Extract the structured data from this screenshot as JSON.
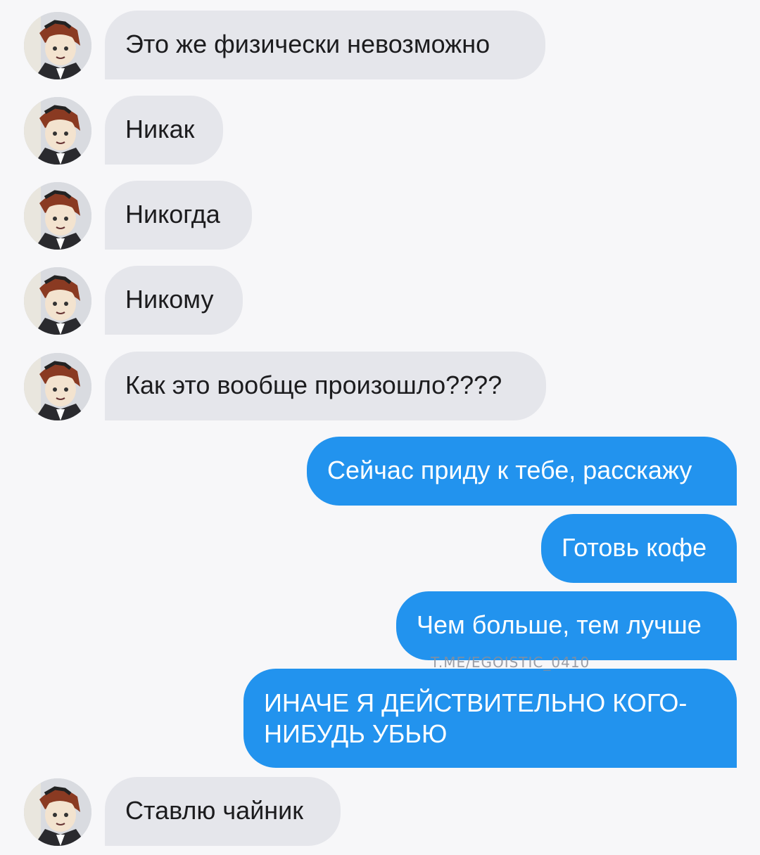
{
  "messages": [
    {
      "side": "in",
      "text": "Это же физически невозможно"
    },
    {
      "side": "in",
      "text": "Никак"
    },
    {
      "side": "in",
      "text": "Никогда"
    },
    {
      "side": "in",
      "text": "Никому"
    },
    {
      "side": "in",
      "text": "Как это вообще произошло????"
    },
    {
      "side": "out",
      "text": "Сейчас приду к тебе, расскажу"
    },
    {
      "side": "out",
      "text": "Готовь кофе"
    },
    {
      "side": "out",
      "text": "Чем больше, тем лучше"
    },
    {
      "side": "out",
      "text": "ИНАЧЕ Я ДЕЙСТВИТЕЛЬНО КОГО-\nНИБУДЬ УБЬЮ"
    },
    {
      "side": "in",
      "text": "Ставлю чайник"
    }
  ],
  "watermark": "T.ME/EGOISTIC_0410",
  "colors": {
    "background": "#f7f7f9",
    "incoming_bubble": "#e5e6eb",
    "outgoing_bubble": "#2293ee"
  },
  "icons": {
    "contact_avatar": "avatar-icon"
  }
}
